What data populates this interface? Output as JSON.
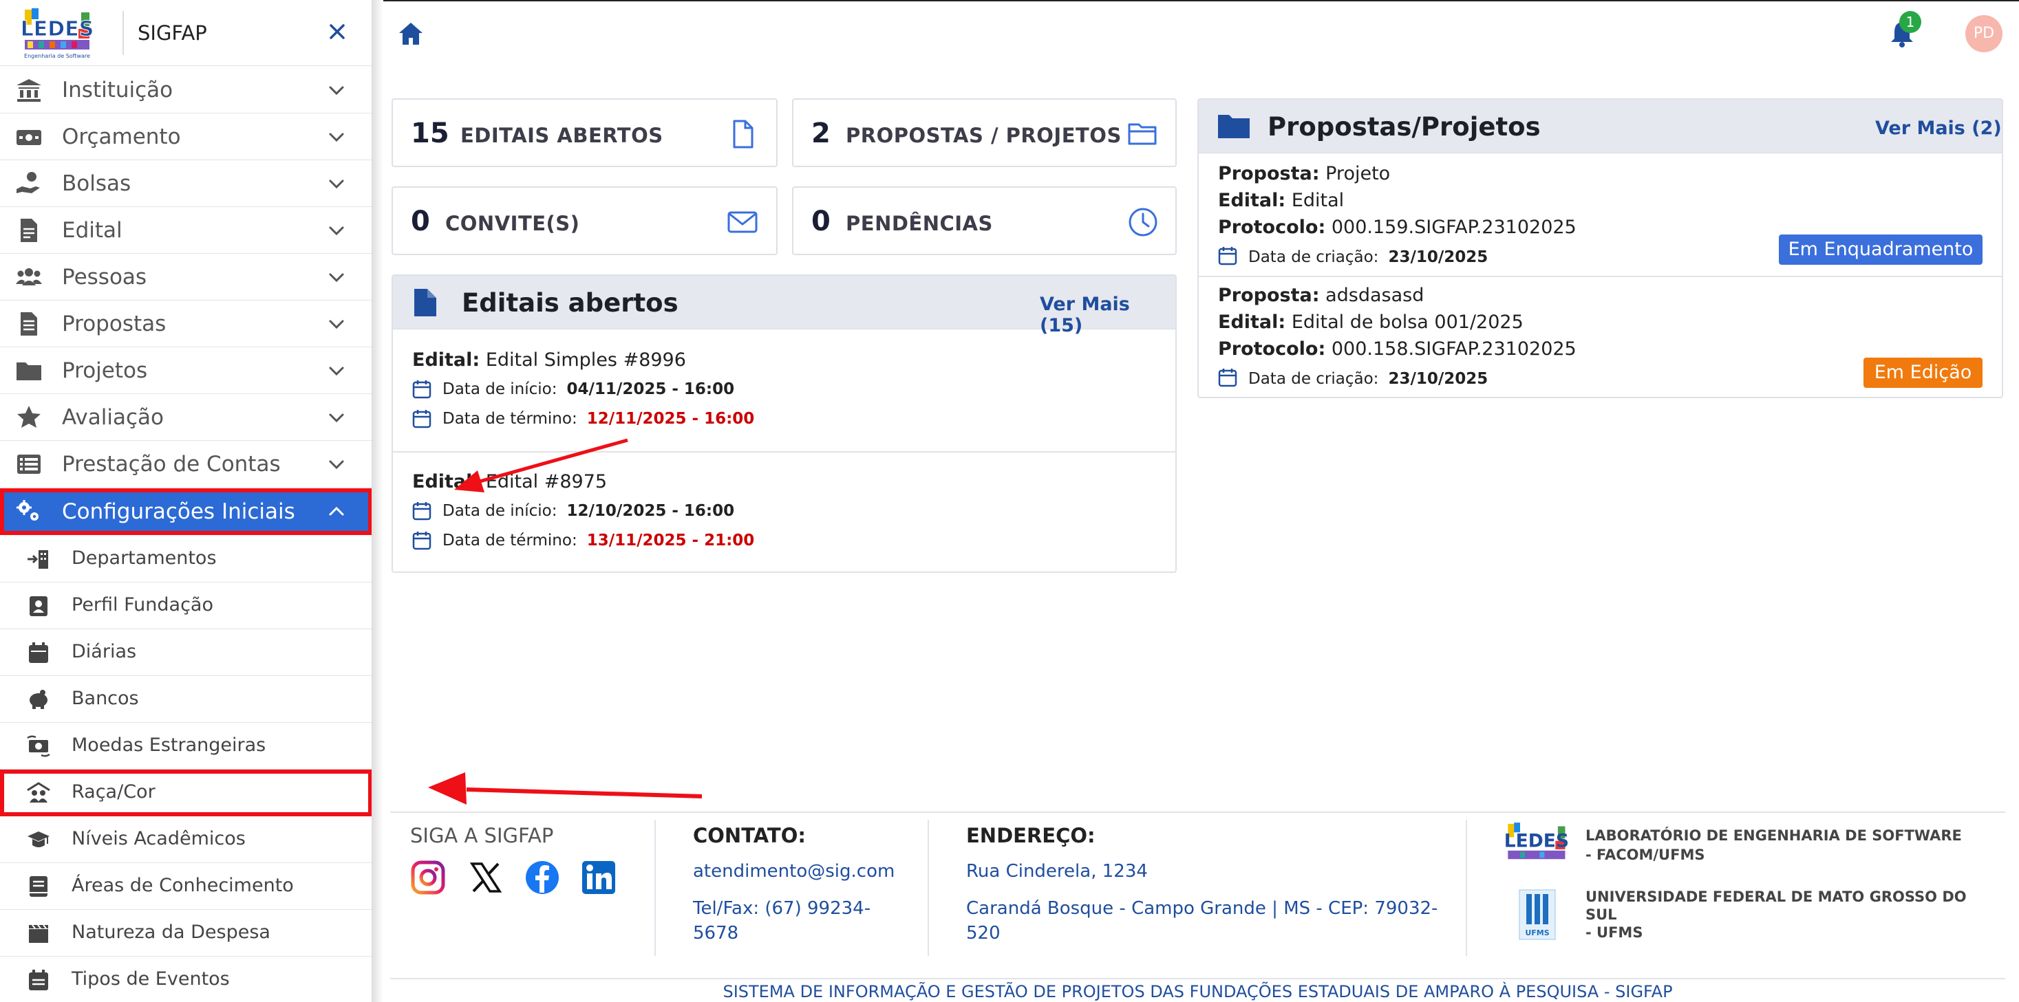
{
  "sidebar": {
    "title": "SIGFAP",
    "logo_text": "LEDES",
    "logo_subtext": "Engenharia de Software",
    "items": [
      {
        "label": "Instituição",
        "icon": "bank-icon"
      },
      {
        "label": "Orçamento",
        "icon": "money-bill-icon"
      },
      {
        "label": "Bolsas",
        "icon": "hand-coin-icon"
      },
      {
        "label": "Edital",
        "icon": "document-icon"
      },
      {
        "label": "Pessoas",
        "icon": "users-icon"
      },
      {
        "label": "Propostas",
        "icon": "file-text-icon"
      },
      {
        "label": "Projetos",
        "icon": "folder-icon"
      },
      {
        "label": "Avaliação",
        "icon": "star-icon"
      },
      {
        "label": "Prestação de Contas",
        "icon": "list-icon"
      },
      {
        "label": "Configurações Iniciais",
        "icon": "gears-icon"
      }
    ],
    "subitems": [
      {
        "label": "Departamentos",
        "icon": "building-arrow-icon"
      },
      {
        "label": "Perfil Fundação",
        "icon": "id-badge-icon"
      },
      {
        "label": "Diárias",
        "icon": "calendar-icon"
      },
      {
        "label": "Bancos",
        "icon": "piggy-bank-icon"
      },
      {
        "label": "Moedas Estrangeiras",
        "icon": "money-exchange-icon"
      },
      {
        "label": "Raça/Cor",
        "icon": "people-roof-icon"
      },
      {
        "label": "Níveis Acadêmicos",
        "icon": "graduation-cap-icon"
      },
      {
        "label": "Áreas de Conhecimento",
        "icon": "book-icon"
      },
      {
        "label": "Natureza da Despesa",
        "icon": "film-icon"
      },
      {
        "label": "Tipos de Eventos",
        "icon": "calendar-list-icon"
      }
    ]
  },
  "topbar": {
    "notification_count": "1",
    "avatar_initials": "PD"
  },
  "stats": [
    {
      "number": "15",
      "label": "EDITAIS ABERTOS"
    },
    {
      "number": "2",
      "label": "PROPOSTAS / PROJETOS"
    },
    {
      "number": "0",
      "label": "CONVITE(S)"
    },
    {
      "number": "0",
      "label": "PENDÊNCIAS"
    }
  ],
  "editais": {
    "title": "Editais abertos",
    "more": "Ver Mais (15)",
    "start_label": "Data de início:",
    "end_label": "Data de término:",
    "edital_label": "Edital:",
    "items": [
      {
        "name": "Edital Simples #8996",
        "start": "04/11/2025 - 16:00",
        "end": "12/11/2025 - 16:00"
      },
      {
        "name": "Edital #8975",
        "start": "12/10/2025 - 16:00",
        "end": "13/11/2025 - 21:00"
      }
    ]
  },
  "propostas": {
    "title": "Propostas/Projetos",
    "more": "Ver Mais (2)",
    "proposta_label": "Proposta:",
    "edital_label": "Edital:",
    "protocolo_label": "Protocolo:",
    "created_label": "Data de criação:",
    "items": [
      {
        "proposta": "Projeto",
        "edital": "Edital",
        "protocolo": "000.159.SIGFAP.23102025",
        "created": "23/10/2025",
        "status": "Em Enquadramento",
        "status_color": "#3a6fdc"
      },
      {
        "proposta": "adsdasasd",
        "edital": "Edital de bolsa 001/2025",
        "protocolo": "000.158.SIGFAP.23102025",
        "created": "23/10/2025",
        "status": "Em Edição",
        "status_color": "#f07a0d"
      }
    ]
  },
  "footer": {
    "follow": "SIGA A SIGFAP",
    "contact_title": "CONTATO:",
    "email": "atendimento@sig.com",
    "phone_line1": "Tel/Fax: (67) 99234-",
    "phone_line2": "5678",
    "address_title": "ENDEREÇO:",
    "street": "Rua Cinderela, 1234",
    "city_line1": "Carandá Bosque - Campo Grande | MS - CEP: 79032-",
    "city_line2": "520",
    "lab_line1": "LABORATÓRIO DE ENGENHARIA DE SOFTWARE",
    "lab_line2": "- FACOM/UFMS",
    "univ_line1": "UNIVERSIDADE FEDERAL DE MATO GROSSO DO",
    "univ_line2": "SUL",
    "univ_line3": "- UFMS",
    "univ_logo_text": "UFMS",
    "bottom": "SISTEMA DE INFORMAÇÃO E GESTÃO DE PROJETOS DAS FUNDAÇÕES ESTADUAIS DE AMPARO À PESQUISA - SIGFAP"
  },
  "colors": {
    "primary": "#1f4e9e",
    "active": "#2c6ad6",
    "highlight": "#ee0f17",
    "danger": "#c00000"
  }
}
